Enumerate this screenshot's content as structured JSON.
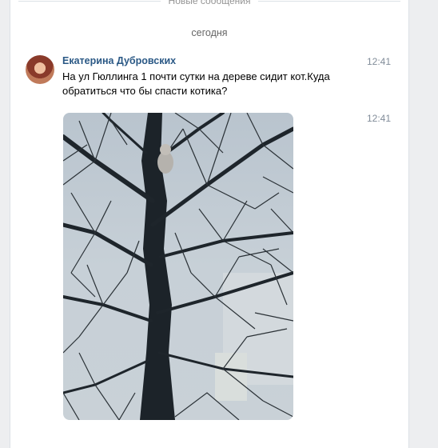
{
  "chat": {
    "new_messages_label": "Новые сообщения",
    "date_separator": "сегодня"
  },
  "message": {
    "author": "Екатерина Дубровских",
    "time": "12:41",
    "text": "На ул Гюллинга 1 почти сутки на дереве сидит кот.Куда обратиться что бы спасти котика?",
    "photo_time": "12:41"
  },
  "colors": {
    "author": "#2a5885",
    "background": "#edeef0",
    "panel": "#ffffff"
  }
}
